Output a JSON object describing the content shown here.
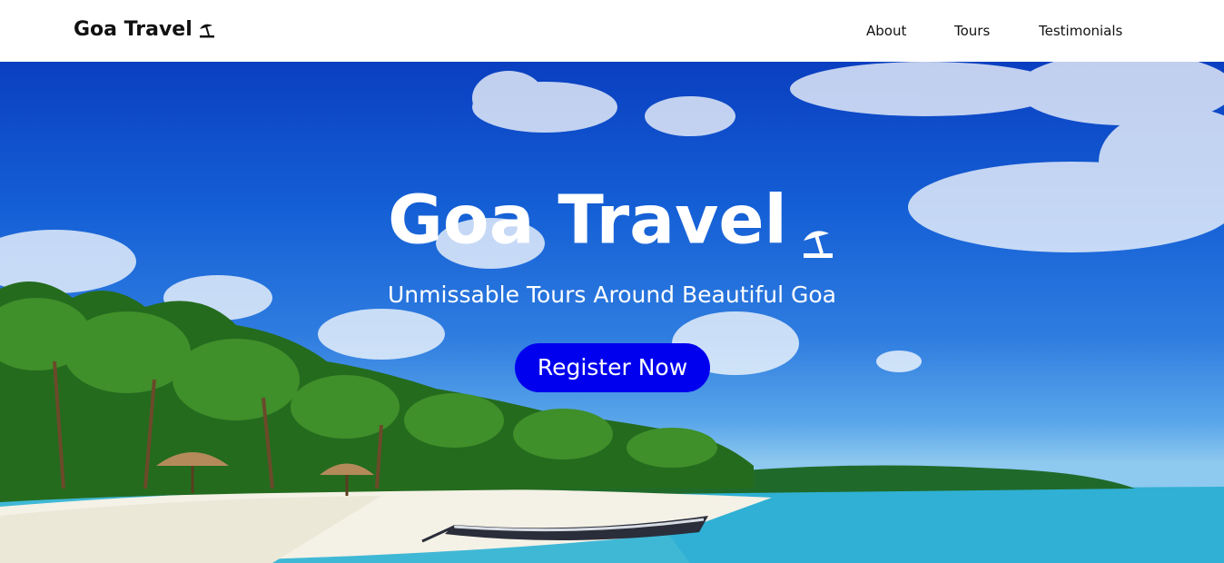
{
  "navbar": {
    "brand": "Goa Travel",
    "brand_icon": "beach-umbrella-icon",
    "links": [
      "About",
      "Tours",
      "Testimonials"
    ]
  },
  "hero": {
    "title": "Goa Travel",
    "title_icon": "beach-umbrella-icon",
    "subtitle": "Unmissable Tours Around Beautiful Goa",
    "cta_label": "Register Now",
    "background_image": "tropical-beach-with-palm-trees-and-boat"
  },
  "colors": {
    "nav_bg": "#ffffff",
    "nav_text": "#111111",
    "hero_text": "#ffffff",
    "cta_bg": "#0000ee"
  }
}
